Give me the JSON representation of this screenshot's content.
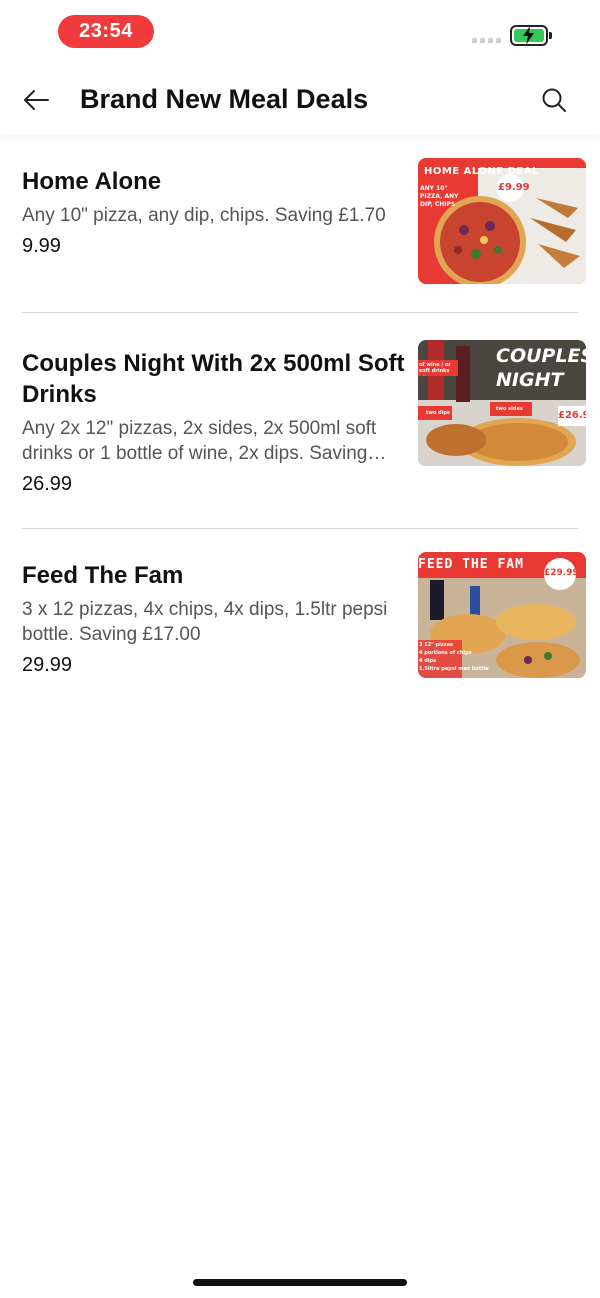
{
  "status_bar": {
    "time": "23:54",
    "time_pill_color": "#ef3b3b",
    "battery_color": "#35c759"
  },
  "header": {
    "back_icon": "arrow-left-icon",
    "title": "Brand New Meal Deals",
    "search_icon": "search-icon"
  },
  "deals": [
    {
      "name": "Home Alone",
      "description": "Any 10\" pizza, any dip, chips. Saving £1.70",
      "price": "9.99",
      "image": {
        "banner": "HOME ALONE DEAL",
        "caption": "ANY 10\" PIZZA, ANY DIP, CHIPS",
        "price_tag": "£9.99"
      }
    },
    {
      "name": "Couples Night With 2x 500ml Soft Drinks",
      "description": "Any 2x 12\" pizzas, 2x sides, 2x 500ml soft drinks or 1 bottle of wine, 2x dips. Saving…",
      "price": "26.99",
      "image": {
        "banner": "COUPLES NIGHT",
        "price_tag": "£26.9",
        "labels": [
          "of wine / or soft drinks",
          "two dips",
          "two sides"
        ]
      }
    },
    {
      "name": "Feed The Fam",
      "description": "3 x 12 pizzas, 4x chips, 4x dips, 1.5ltr pepsi bottle. Saving £17.00",
      "price": "29.99",
      "image": {
        "banner": "FEED THE FAM",
        "price_tag": "£29.99",
        "labels": [
          "3 12\" pizzas",
          "4 portions of chips",
          "4 dips",
          "1.5litre pepsi max bottle"
        ]
      }
    }
  ]
}
